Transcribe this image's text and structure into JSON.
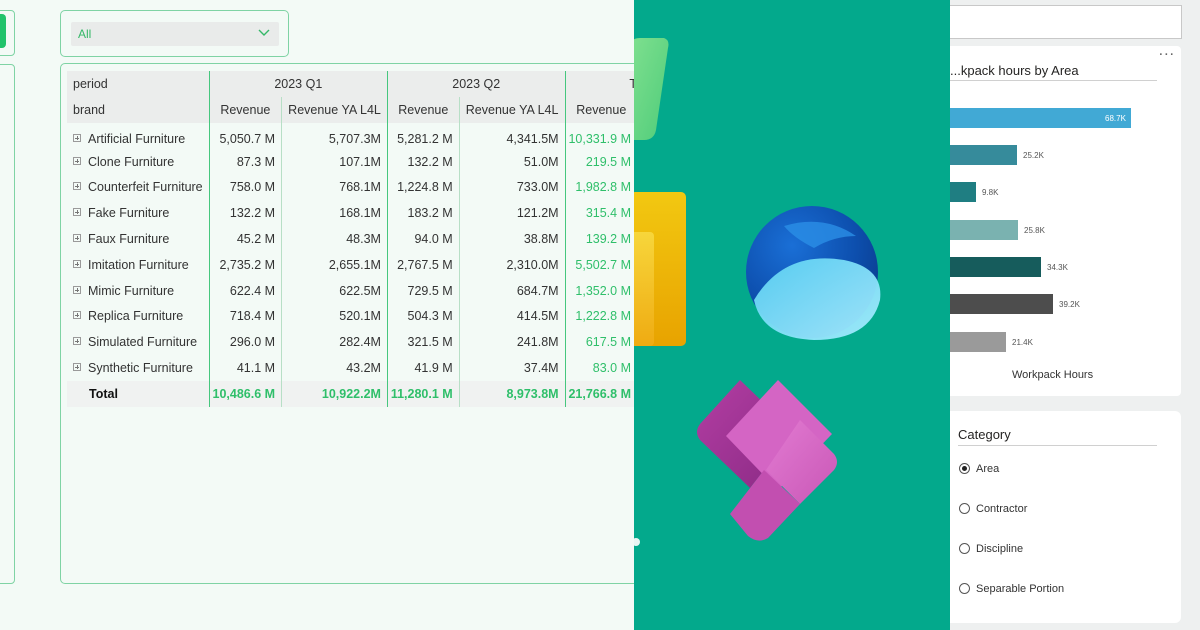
{
  "slicer": {
    "selected": "All"
  },
  "matrix": {
    "row_header_period": "period",
    "row_header_brand": "brand",
    "periods": [
      "2023 Q1",
      "2023 Q2",
      "T"
    ],
    "column_titles": [
      "Revenue",
      "Revenue YA L4L",
      "Revenue",
      "Revenue YA L4L",
      "Revenue"
    ],
    "rows": [
      {
        "brand": "Artificial Furniture",
        "values": [
          "5,050.7 M",
          "5,707.3M",
          "5,281.2 M",
          "4,341.5M",
          "10,331.9 M"
        ]
      },
      {
        "brand": "Clone Furniture",
        "values": [
          "87.3 M",
          "107.1M",
          "132.2 M",
          "51.0M",
          "219.5 M"
        ]
      },
      {
        "brand": "Counterfeit Furniture",
        "values": [
          "758.0 M",
          "768.1M",
          "1,224.8 M",
          "733.0M",
          "1,982.8 M"
        ]
      },
      {
        "brand": "Fake Furniture",
        "values": [
          "132.2 M",
          "168.1M",
          "183.2 M",
          "121.2M",
          "315.4 M"
        ]
      },
      {
        "brand": "Faux Furniture",
        "values": [
          "45.2 M",
          "48.3M",
          "94.0 M",
          "38.8M",
          "139.2 M"
        ]
      },
      {
        "brand": "Imitation Furniture",
        "values": [
          "2,735.2 M",
          "2,655.1M",
          "2,767.5 M",
          "2,310.0M",
          "5,502.7 M"
        ]
      },
      {
        "brand": "Mimic Furniture",
        "values": [
          "622.4 M",
          "622.5M",
          "729.5 M",
          "684.7M",
          "1,352.0 M"
        ]
      },
      {
        "brand": "Replica Furniture",
        "values": [
          "718.4 M",
          "520.1M",
          "504.3 M",
          "414.5M",
          "1,222.8 M"
        ]
      },
      {
        "brand": "Simulated Furniture",
        "values": [
          "296.0 M",
          "282.4M",
          "321.5 M",
          "241.8M",
          "617.5 M"
        ]
      },
      {
        "brand": "Synthetic Furniture",
        "values": [
          "41.1 M",
          "43.2M",
          "41.9 M",
          "37.4M",
          "83.0 M"
        ]
      }
    ],
    "total": {
      "label": "Total",
      "values": [
        "10,486.6 M",
        "10,922.2M",
        "11,280.1 M",
        "8,973.8M",
        "21,766.8 M"
      ]
    }
  },
  "bar_chart": {
    "title": "...kpack hours by Area",
    "x_axis_title": "Workpack Hours",
    "more_options": "...",
    "colors": [
      "#41a9d5",
      "#368b9b",
      "#1f7e82",
      "#7ab2b0",
      "#165c5c",
      "#4d4d4d",
      "#9a9a9a"
    ]
  },
  "chart_data": {
    "type": "bar",
    "orientation": "horizontal",
    "title": "...kpack hours by Area",
    "xlabel": "Workpack Hours",
    "categories": [
      "",
      "",
      "",
      "",
      "",
      "",
      ""
    ],
    "values": [
      68.7,
      25.2,
      9.8,
      25.8,
      34.3,
      39.2,
      21.4
    ],
    "value_labels": [
      "68.7K",
      "25.2K",
      "9.8K",
      "25.8K",
      "34.3K",
      "39.2K",
      "21.4K"
    ],
    "xlim": [
      0,
      72
    ]
  },
  "category_slicer": {
    "title": "Category",
    "options": [
      "Area",
      "Contractor",
      "Discipline",
      "Separable Portion"
    ],
    "selected": "Area"
  }
}
